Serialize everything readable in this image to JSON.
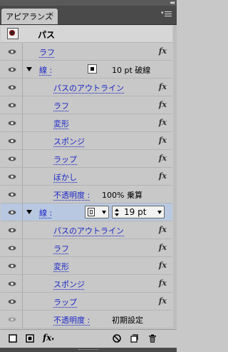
{
  "panel": {
    "tab_title": "アピアランス",
    "close_glyph": "×",
    "collapse_glyph": "◂◂"
  },
  "header": {
    "title": "パス"
  },
  "rows": [
    {
      "label": "ラフ",
      "fx": "fx"
    },
    {
      "label": "線 :",
      "value": "10 pt 破線"
    },
    {
      "label": "パスのアウトライン",
      "fx": "fx"
    },
    {
      "label": "ラフ",
      "fx": "fx"
    },
    {
      "label": "変形",
      "fx": "fx"
    },
    {
      "label": "スポンジ",
      "fx": "fx"
    },
    {
      "label": "ラップ",
      "fx": "fx"
    },
    {
      "label": "ぼかし",
      "fx": "fx"
    },
    {
      "label": "不透明度 :",
      "value": "100% 乗算"
    },
    {
      "label": "線 :",
      "stroke_weight": "19 pt"
    },
    {
      "label": "パスのアウトライン",
      "fx": "fx"
    },
    {
      "label": "ラフ",
      "fx": "fx"
    },
    {
      "label": "変形",
      "fx": "fx"
    },
    {
      "label": "スポンジ",
      "fx": "fx"
    },
    {
      "label": "ラップ",
      "fx": "fx"
    },
    {
      "label": "不透明度 :",
      "value": "初期設定"
    }
  ],
  "bottom": {
    "fx_label": "fx"
  }
}
